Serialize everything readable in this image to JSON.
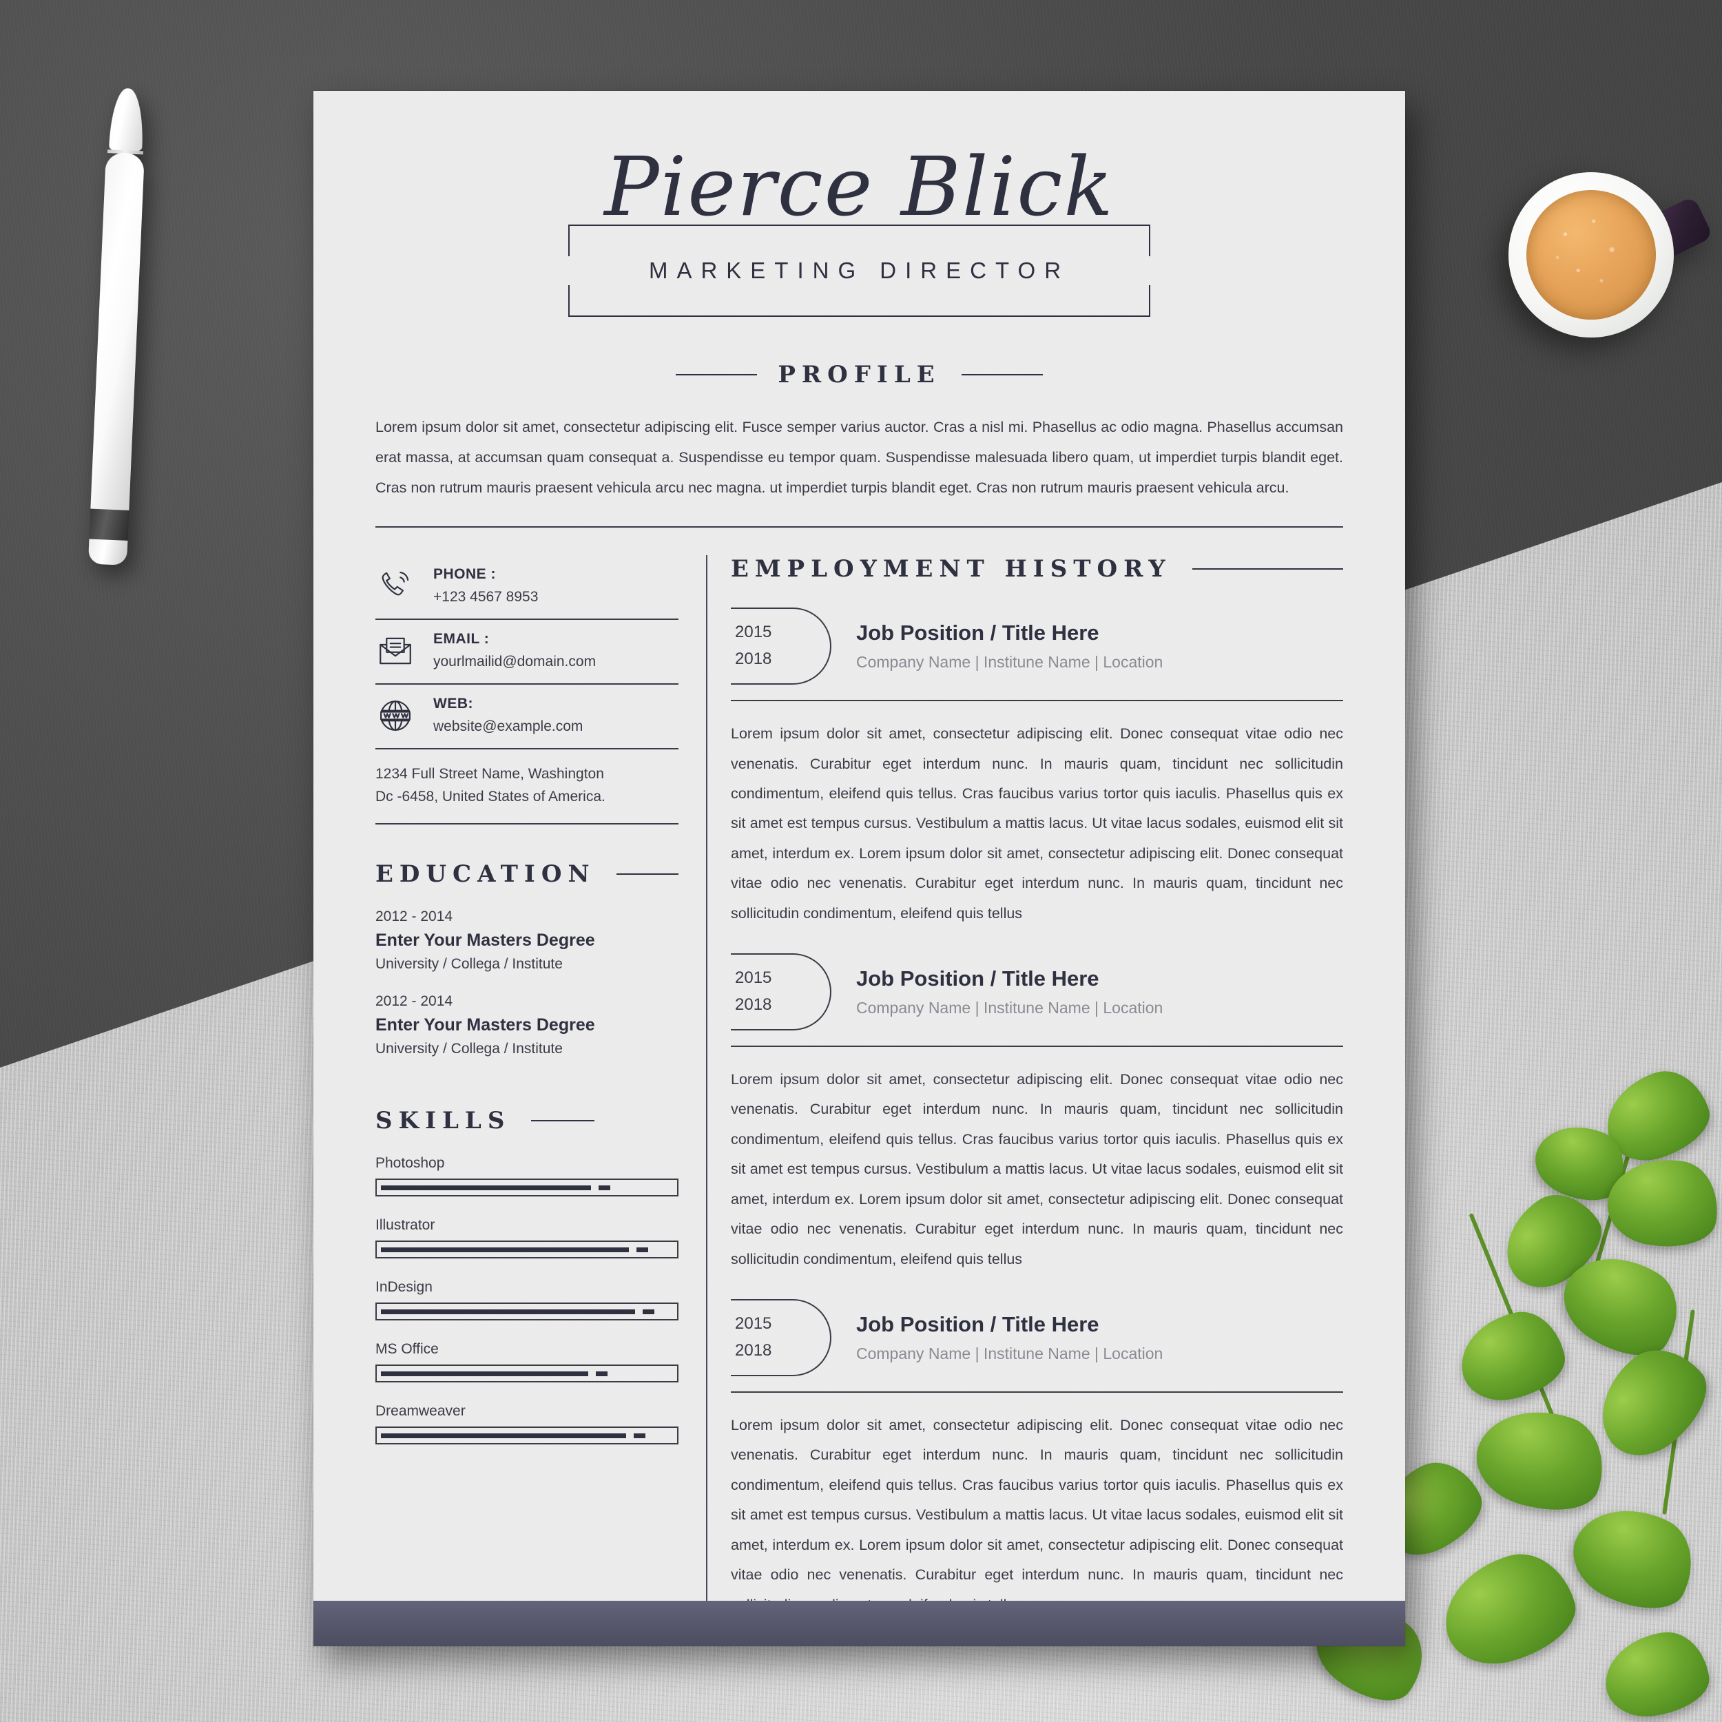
{
  "scene": {
    "objects": {
      "stylus": "white-stylus-pen",
      "coffee_cup": "coffee-cup-top-view",
      "plant": "pothos-plant",
      "backdrop_dark": "dark-gray-felt",
      "backdrop_light": "light-concrete"
    }
  },
  "resume": {
    "header": {
      "name": "Pierce Blick",
      "job_title": "MARKETING DIRECTOR"
    },
    "profile": {
      "heading": "PROFILE",
      "text": "Lorem ipsum dolor sit amet, consectetur adipiscing elit. Fusce semper varius auctor. Cras a nisl mi. Phasellus ac odio magna. Phasellus accumsan erat massa, at accumsan quam consequat a. Suspendisse eu tempor quam. Suspendisse malesuada libero quam, ut imperdiet turpis blandit eget. Cras non rutrum mauris praesent vehicula arcu nec magna. ut imperdiet turpis blandit eget. Cras non rutrum mauris praesent vehicula arcu."
    },
    "contact": {
      "items": [
        {
          "icon": "phone-icon",
          "label": "PHONE :",
          "value": "+123 4567 8953"
        },
        {
          "icon": "email-icon",
          "label": "EMAIL :",
          "value": "yourlmailid@domain.com"
        },
        {
          "icon": "web-globe-icon",
          "label": "WEB:",
          "value": "website@example.com"
        }
      ],
      "address_line1": "1234 Full Street Name, Washington",
      "address_line2": "Dc -6458, United States of America."
    },
    "education": {
      "heading": "EDUCATION",
      "items": [
        {
          "years": "2012 - 2014",
          "degree": "Enter Your Masters Degree",
          "institute": "University / Collega / Institute"
        },
        {
          "years": "2012 - 2014",
          "degree": "Enter Your Masters Degree",
          "institute": "University / Collega / Institute"
        }
      ]
    },
    "skills": {
      "heading": "SKILLS",
      "items": [
        {
          "name": "Photoshop",
          "level": 80
        },
        {
          "name": "Illustrator",
          "level": 93
        },
        {
          "name": "InDesign",
          "level": 95
        },
        {
          "name": "MS Office",
          "level": 79
        },
        {
          "name": "Dreamweaver",
          "level": 92
        }
      ]
    },
    "employment": {
      "heading": "EMPLOYMENT HISTORY",
      "jobs": [
        {
          "year_start": "2015",
          "year_end": "2018",
          "position": "Job Position / Title Here",
          "company": "Company Name | Institune Name | Location",
          "description": "Lorem ipsum dolor sit amet, consectetur adipiscing elit. Donec consequat vitae odio nec venenatis. Curabitur eget interdum nunc. In mauris quam, tincidunt nec sollicitudin condimentum, eleifend quis tellus. Cras faucibus varius tortor quis iaculis. Phasellus quis ex sit amet est tempus cursus. Vestibulum a mattis lacus. Ut vitae lacus sodales, euismod elit sit amet, interdum ex. Lorem ipsum dolor sit amet, consectetur adipiscing elit. Donec consequat vitae odio nec venenatis. Curabitur eget interdum nunc. In mauris quam, tincidunt nec sollicitudin condimentum, eleifend quis tellus"
        },
        {
          "year_start": "2015",
          "year_end": "2018",
          "position": "Job Position / Title Here",
          "company": "Company Name | Institune Name | Location",
          "description": "Lorem ipsum dolor sit amet, consectetur adipiscing elit. Donec consequat vitae odio nec venenatis. Curabitur eget interdum nunc. In mauris quam, tincidunt nec sollicitudin condimentum, eleifend quis tellus. Cras faucibus varius tortor quis iaculis. Phasellus quis ex sit amet est tempus cursus. Vestibulum a mattis lacus. Ut vitae lacus sodales, euismod elit sit amet, interdum ex. Lorem ipsum dolor sit amet, consectetur adipiscing elit. Donec consequat vitae odio nec venenatis. Curabitur eget interdum nunc. In mauris quam, tincidunt nec sollicitudin condimentum, eleifend quis tellus"
        },
        {
          "year_start": "2015",
          "year_end": "2018",
          "position": "Job Position / Title Here",
          "company": "Company Name | Institune Name | Location",
          "description": "Lorem ipsum dolor sit amet, consectetur adipiscing elit. Donec consequat vitae odio nec venenatis. Curabitur eget interdum nunc. In mauris quam, tincidunt nec sollicitudin condimentum, eleifend quis tellus. Cras faucibus varius tortor quis iaculis. Phasellus quis ex sit amet est tempus cursus. Vestibulum a mattis lacus. Ut vitae lacus sodales, euismod elit sit amet, interdum ex. Lorem ipsum dolor sit amet, consectetur adipiscing elit. Donec consequat vitae odio nec venenatis. Curabitur eget interdum nunc. In mauris quam, tincidunt nec sollicitudin condimentum, eleifend quis tellus"
        }
      ]
    },
    "colors": {
      "ink": "#2f3040",
      "body_text": "#3b3b46",
      "muted": "#8a8a93",
      "paper": "#ececec",
      "footer_bar": "#56566b"
    }
  }
}
